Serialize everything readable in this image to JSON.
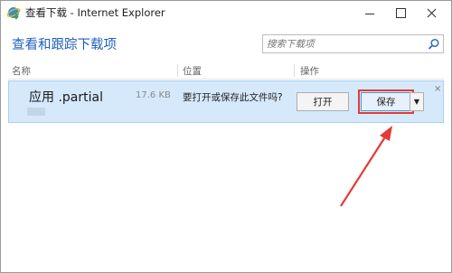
{
  "window": {
    "title": "查看下载 - Internet Explorer",
    "icon": "ie-download-icon"
  },
  "header": {
    "title": "查看和跟踪下载项",
    "search_placeholder": "搜索下载项"
  },
  "columns": {
    "name": "名称",
    "location": "位置",
    "actions": "操作"
  },
  "download": {
    "file_name": "应用 .partial",
    "size": "17.6 KB",
    "prompt": "要打开或保存此文件吗?",
    "open_label": "打开",
    "save_label": "保存",
    "dropdown_glyph": "▼",
    "dismiss_glyph": "×"
  },
  "colors": {
    "accent": "#1e5fbd",
    "row_highlight": "#d5e9fb",
    "annotation": "#e53935"
  }
}
